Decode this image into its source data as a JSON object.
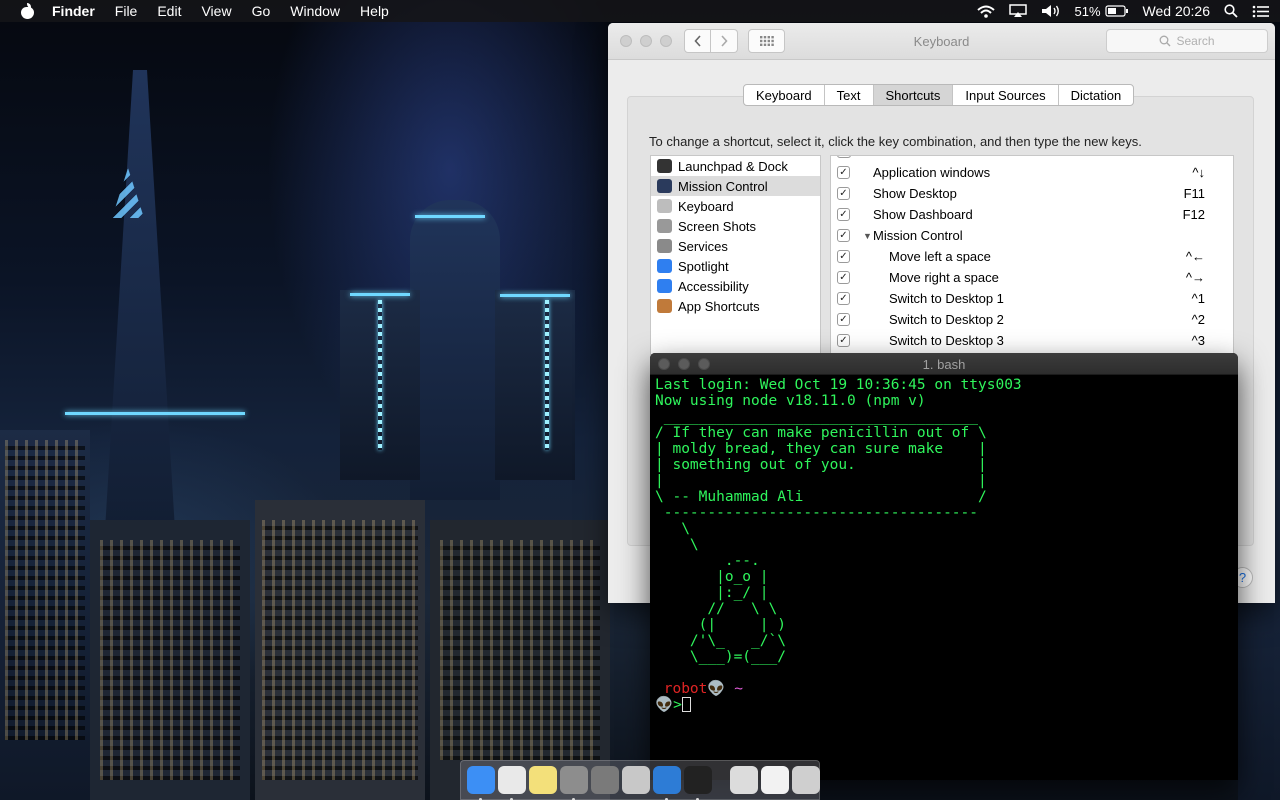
{
  "menubar": {
    "app_name": "Finder",
    "menus": [
      "File",
      "Edit",
      "View",
      "Go",
      "Window",
      "Help"
    ],
    "battery": "51%",
    "clock": "Wed 20:26"
  },
  "prefs": {
    "title": "Keyboard",
    "search_placeholder": "Search",
    "tabs": [
      "Keyboard",
      "Text",
      "Shortcuts",
      "Input Sources",
      "Dictation"
    ],
    "active_tab": "Shortcuts",
    "instruction": "To change a shortcut, select it, click the key combination, and then type the new keys.",
    "categories": [
      {
        "label": "Launchpad & Dock",
        "icon": "launchpad-dock-icon",
        "color": "#333333"
      },
      {
        "label": "Mission Control",
        "icon": "mission-control-icon",
        "color": "#2a3a5c"
      },
      {
        "label": "Keyboard",
        "icon": "keyboard-icon",
        "color": "#bdbdbd"
      },
      {
        "label": "Screen Shots",
        "icon": "screenshot-icon",
        "color": "#999999"
      },
      {
        "label": "Services",
        "icon": "gear-icon",
        "color": "#8a8a8a"
      },
      {
        "label": "Spotlight",
        "icon": "spotlight-icon",
        "color": "#2f7ff0"
      },
      {
        "label": "Accessibility",
        "icon": "accessibility-icon",
        "color": "#2f7ff0"
      },
      {
        "label": "App Shortcuts",
        "icon": "app-shortcuts-icon",
        "color": "#c07a3a"
      }
    ],
    "selected_category": "Mission Control",
    "shortcuts": [
      {
        "label": "Application windows",
        "key": "^↓",
        "checked": true,
        "indent": 0
      },
      {
        "label": "Show Desktop",
        "key": "F11",
        "checked": true,
        "indent": 0
      },
      {
        "label": "Show Dashboard",
        "key": "F12",
        "checked": true,
        "indent": 0
      },
      {
        "label": "Mission Control",
        "key": "",
        "checked": true,
        "indent": 0,
        "group": true
      },
      {
        "label": "Move left a space",
        "key": "^←",
        "checked": true,
        "indent": 1
      },
      {
        "label": "Move right a space",
        "key": "^→",
        "checked": true,
        "indent": 1
      },
      {
        "label": "Switch to Desktop 1",
        "key": "^1",
        "checked": true,
        "indent": 1
      },
      {
        "label": "Switch to Desktop 2",
        "key": "^2",
        "checked": true,
        "indent": 1
      },
      {
        "label": "Switch to Desktop 3",
        "key": "^3",
        "checked": true,
        "indent": 1
      }
    ],
    "help": "?"
  },
  "terminal": {
    "title": "1. bash",
    "lines": [
      "Last login: Wed Oct 19 10:36:45 on ttys003",
      "Now using node v18.11.0 (npm v)",
      " ____________________________________",
      "/ If they can make penicillin out of \\",
      "| moldy bread, they can sure make    |",
      "| something out of you.              |",
      "|                                    |",
      "\\ -- Muhammad Ali                    /",
      " ------------------------------------",
      "   \\",
      "    \\",
      "        .--.",
      "       |o_o |",
      "       |:_/ |",
      "      //   \\ \\",
      "     (|     | )",
      "    /'\\_   _/`\\",
      "    \\___)=(___/",
      ""
    ],
    "prompt_user": "robot",
    "prompt_alien": "👽",
    "prompt_tilde": "~",
    "prompt_arrow": ">"
  },
  "dock": {
    "apps": [
      {
        "name": "finder-icon",
        "color": "#3c8ff5",
        "running": true
      },
      {
        "name": "chrome-icon",
        "color": "#e9e9e9",
        "running": true
      },
      {
        "name": "notes-icon",
        "color": "#f3e07a",
        "running": false
      },
      {
        "name": "system-preferences-icon",
        "color": "#8d8d8d",
        "running": true
      },
      {
        "name": "launchpad-icon",
        "color": "#7a7a7a",
        "running": false
      },
      {
        "name": "sequel-pro-icon",
        "color": "#c8c8c8",
        "running": false
      },
      {
        "name": "vscode-icon",
        "color": "#2d7cd6",
        "running": true
      },
      {
        "name": "terminal-icon",
        "color": "#222222",
        "running": true
      }
    ],
    "docs": [
      {
        "name": "downloads-stack-icon",
        "color": "#dcdcdc"
      },
      {
        "name": "document-stack-icon",
        "color": "#f2f2f2"
      },
      {
        "name": "trash-icon",
        "color": "#cfcfcf"
      }
    ]
  }
}
